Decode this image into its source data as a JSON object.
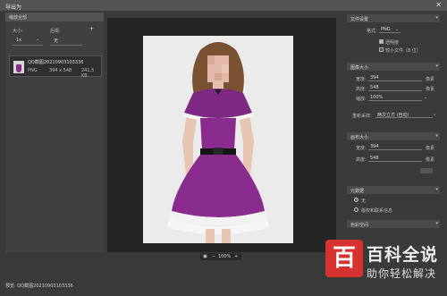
{
  "window": {
    "title": "导出为",
    "close_glyph": "✕"
  },
  "left_panel": {
    "header": "缩放全部",
    "size_label": "大小:",
    "size_value": "1x",
    "suffix_label": "后缀:",
    "suffix_value": "无",
    "add_glyph": "+",
    "asset": {
      "name": "QQ截图20210903103336",
      "format": "PNG",
      "dimensions": "394 x 548",
      "filesize": "241.5 KB"
    }
  },
  "zoom": {
    "value": "100%",
    "minus": "−",
    "plus": "+"
  },
  "right_panel": {
    "file_settings": {
      "title": "文件设置",
      "format_label": "格式:",
      "format_value": "PNG",
      "transparency_label": "透明度",
      "transparency_checked": true,
      "smaller_file_label": "较小文件（8 位）",
      "smaller_file_checked": false
    },
    "image_size": {
      "title": "图像大小",
      "width_label": "宽度:",
      "width_value": "394",
      "width_unit": "像素",
      "height_label": "高度:",
      "height_value": "548",
      "height_unit": "像素",
      "scale_label": "缩放:",
      "scale_value": "100%",
      "resample_label": "重新采样:",
      "resample_value": "两次立方 (自动)"
    },
    "canvas_size": {
      "title": "画布大小",
      "width_label": "宽度:",
      "width_value": "394",
      "width_unit": "像素",
      "height_label": "高度:",
      "height_value": "548",
      "height_unit": "像素"
    },
    "metadata": {
      "title": "元数据",
      "option_none": "无",
      "option_copyright": "版权和联系信息"
    },
    "color_space": {
      "title": "色彩空间"
    }
  },
  "footer": {
    "text": "预览: QQ截图20210903103336"
  },
  "watermark": {
    "logo_glyph": "百",
    "title": "百科全说",
    "subtitle": "助你轻松解决"
  },
  "colors": {
    "dress": "#8a2b8e",
    "background": "#3a3a3a"
  }
}
